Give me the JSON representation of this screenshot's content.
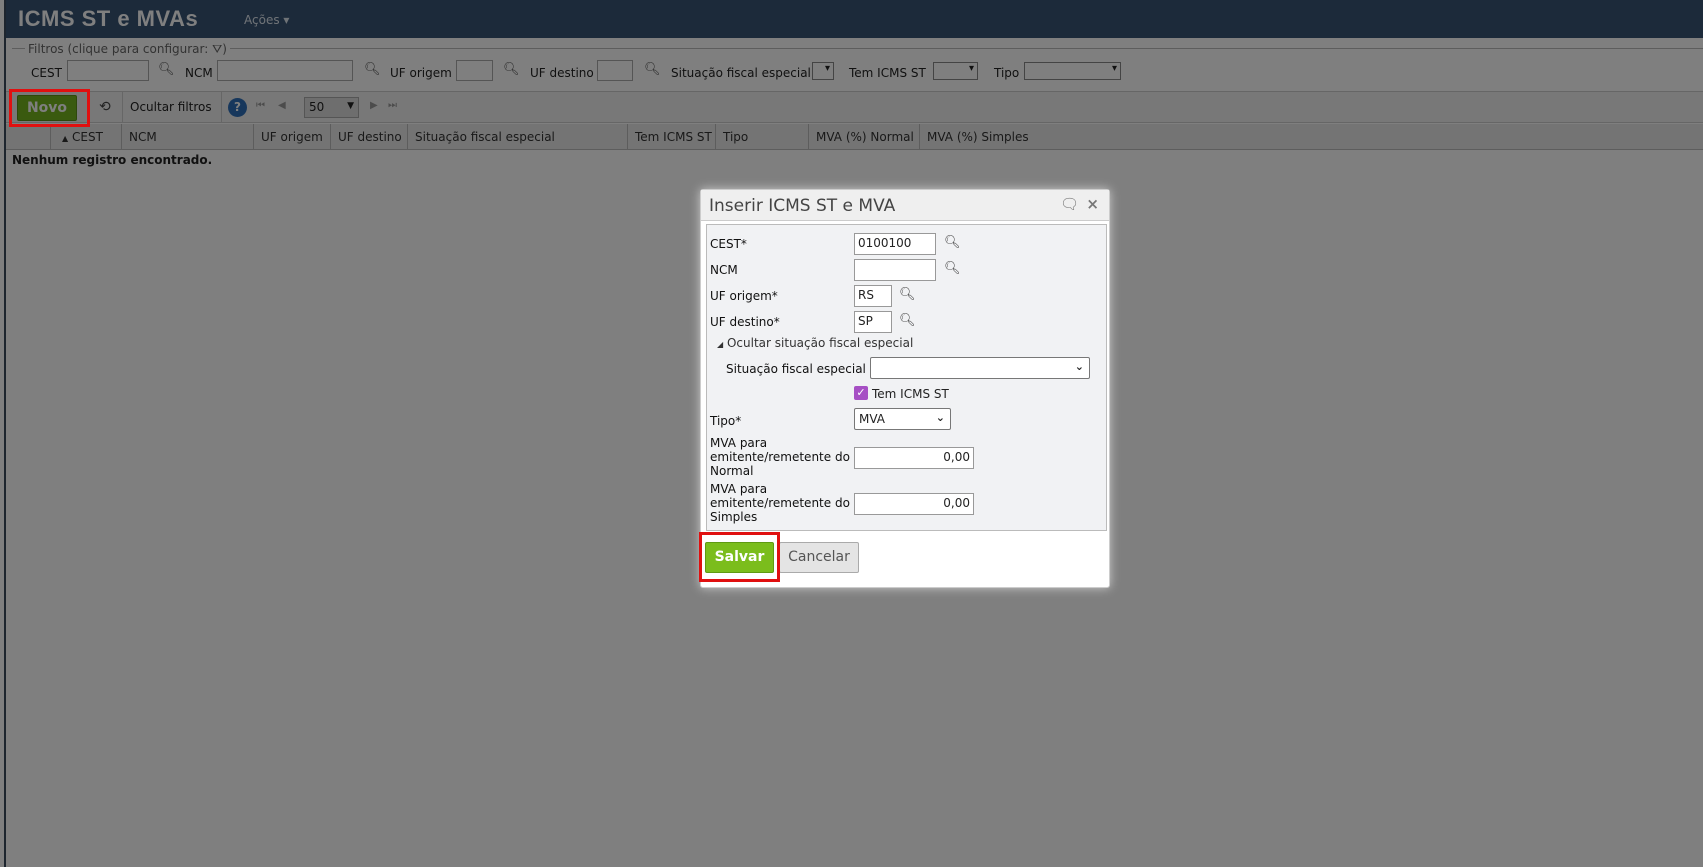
{
  "header": {
    "title": "ICMS ST e MVAs",
    "actions_menu": "Ações"
  },
  "filters": {
    "legend": "Filtros (clique para configurar:",
    "cest_label": "CEST",
    "ncm_label": "NCM",
    "uf_origem_label": "UF origem",
    "uf_destino_label": "UF destino",
    "situacao_label": "Situação fiscal especial",
    "tem_icms_label": "Tem ICMS ST",
    "tipo_label": "Tipo"
  },
  "toolbar": {
    "new_label": "Novo",
    "hide_filters_label": "Ocultar filtros",
    "page_size": "50"
  },
  "grid": {
    "columns": [
      "CEST",
      "NCM",
      "UF origem",
      "UF destino",
      "Situação fiscal especial",
      "Tem ICMS ST",
      "Tipo",
      "MVA (%) Normal",
      "MVA (%) Simples"
    ],
    "empty_message": "Nenhum registro encontrado."
  },
  "modal": {
    "title": "Inserir ICMS ST e MVA",
    "cest_label": "CEST*",
    "cest_value": "0100100",
    "ncm_label": "NCM",
    "ncm_value": "",
    "uf_origem_label": "UF origem*",
    "uf_origem_value": "RS",
    "uf_destino_label": "UF destino*",
    "uf_destino_value": "SP",
    "toggle_label": "Ocultar situação fiscal especial",
    "situacao_label": "Situação fiscal especial",
    "situacao_value": "",
    "tem_icms_label": "Tem ICMS ST",
    "tem_icms_checked": true,
    "tipo_label": "Tipo*",
    "tipo_value": "MVA",
    "mva_normal_label": "MVA para emitente/remetente do Normal",
    "mva_normal_value": "0,00",
    "mva_simples_label": "MVA para emitente/remetente do Simples",
    "mva_simples_value": "0,00",
    "save_label": "Salvar",
    "cancel_label": "Cancelar"
  },
  "colors": {
    "header": "#385575",
    "primary": "#7bbd1c",
    "highlight": "#e01010",
    "checkbox": "#a64fc4"
  }
}
